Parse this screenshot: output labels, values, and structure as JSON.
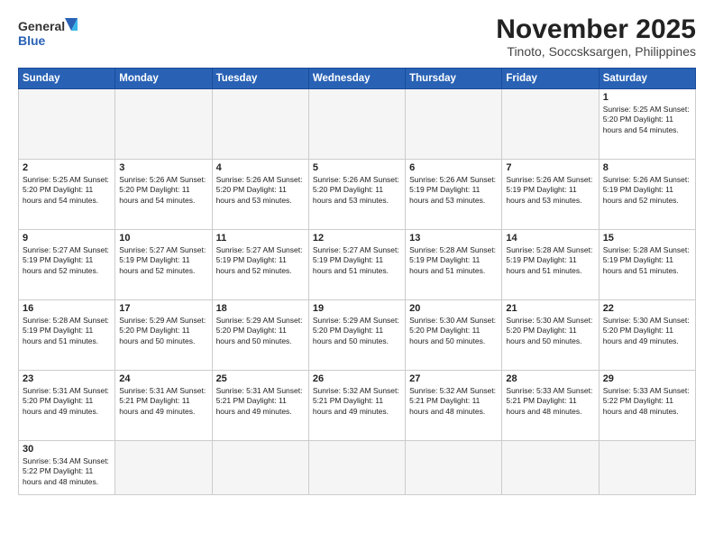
{
  "logo": {
    "line1": "General",
    "line2": "Blue"
  },
  "title": "November 2025",
  "location": "Tinoto, Soccsksargen, Philippines",
  "weekdays": [
    "Sunday",
    "Monday",
    "Tuesday",
    "Wednesday",
    "Thursday",
    "Friday",
    "Saturday"
  ],
  "weeks": [
    [
      {
        "day": "",
        "info": ""
      },
      {
        "day": "",
        "info": ""
      },
      {
        "day": "",
        "info": ""
      },
      {
        "day": "",
        "info": ""
      },
      {
        "day": "",
        "info": ""
      },
      {
        "day": "",
        "info": ""
      },
      {
        "day": "1",
        "info": "Sunrise: 5:25 AM\nSunset: 5:20 PM\nDaylight: 11 hours\nand 54 minutes."
      }
    ],
    [
      {
        "day": "2",
        "info": "Sunrise: 5:25 AM\nSunset: 5:20 PM\nDaylight: 11 hours\nand 54 minutes."
      },
      {
        "day": "3",
        "info": "Sunrise: 5:26 AM\nSunset: 5:20 PM\nDaylight: 11 hours\nand 54 minutes."
      },
      {
        "day": "4",
        "info": "Sunrise: 5:26 AM\nSunset: 5:20 PM\nDaylight: 11 hours\nand 53 minutes."
      },
      {
        "day": "5",
        "info": "Sunrise: 5:26 AM\nSunset: 5:20 PM\nDaylight: 11 hours\nand 53 minutes."
      },
      {
        "day": "6",
        "info": "Sunrise: 5:26 AM\nSunset: 5:19 PM\nDaylight: 11 hours\nand 53 minutes."
      },
      {
        "day": "7",
        "info": "Sunrise: 5:26 AM\nSunset: 5:19 PM\nDaylight: 11 hours\nand 53 minutes."
      },
      {
        "day": "8",
        "info": "Sunrise: 5:26 AM\nSunset: 5:19 PM\nDaylight: 11 hours\nand 52 minutes."
      }
    ],
    [
      {
        "day": "9",
        "info": "Sunrise: 5:27 AM\nSunset: 5:19 PM\nDaylight: 11 hours\nand 52 minutes."
      },
      {
        "day": "10",
        "info": "Sunrise: 5:27 AM\nSunset: 5:19 PM\nDaylight: 11 hours\nand 52 minutes."
      },
      {
        "day": "11",
        "info": "Sunrise: 5:27 AM\nSunset: 5:19 PM\nDaylight: 11 hours\nand 52 minutes."
      },
      {
        "day": "12",
        "info": "Sunrise: 5:27 AM\nSunset: 5:19 PM\nDaylight: 11 hours\nand 51 minutes."
      },
      {
        "day": "13",
        "info": "Sunrise: 5:28 AM\nSunset: 5:19 PM\nDaylight: 11 hours\nand 51 minutes."
      },
      {
        "day": "14",
        "info": "Sunrise: 5:28 AM\nSunset: 5:19 PM\nDaylight: 11 hours\nand 51 minutes."
      },
      {
        "day": "15",
        "info": "Sunrise: 5:28 AM\nSunset: 5:19 PM\nDaylight: 11 hours\nand 51 minutes."
      }
    ],
    [
      {
        "day": "16",
        "info": "Sunrise: 5:28 AM\nSunset: 5:19 PM\nDaylight: 11 hours\nand 51 minutes."
      },
      {
        "day": "17",
        "info": "Sunrise: 5:29 AM\nSunset: 5:20 PM\nDaylight: 11 hours\nand 50 minutes."
      },
      {
        "day": "18",
        "info": "Sunrise: 5:29 AM\nSunset: 5:20 PM\nDaylight: 11 hours\nand 50 minutes."
      },
      {
        "day": "19",
        "info": "Sunrise: 5:29 AM\nSunset: 5:20 PM\nDaylight: 11 hours\nand 50 minutes."
      },
      {
        "day": "20",
        "info": "Sunrise: 5:30 AM\nSunset: 5:20 PM\nDaylight: 11 hours\nand 50 minutes."
      },
      {
        "day": "21",
        "info": "Sunrise: 5:30 AM\nSunset: 5:20 PM\nDaylight: 11 hours\nand 50 minutes."
      },
      {
        "day": "22",
        "info": "Sunrise: 5:30 AM\nSunset: 5:20 PM\nDaylight: 11 hours\nand 49 minutes."
      }
    ],
    [
      {
        "day": "23",
        "info": "Sunrise: 5:31 AM\nSunset: 5:20 PM\nDaylight: 11 hours\nand 49 minutes."
      },
      {
        "day": "24",
        "info": "Sunrise: 5:31 AM\nSunset: 5:21 PM\nDaylight: 11 hours\nand 49 minutes."
      },
      {
        "day": "25",
        "info": "Sunrise: 5:31 AM\nSunset: 5:21 PM\nDaylight: 11 hours\nand 49 minutes."
      },
      {
        "day": "26",
        "info": "Sunrise: 5:32 AM\nSunset: 5:21 PM\nDaylight: 11 hours\nand 49 minutes."
      },
      {
        "day": "27",
        "info": "Sunrise: 5:32 AM\nSunset: 5:21 PM\nDaylight: 11 hours\nand 48 minutes."
      },
      {
        "day": "28",
        "info": "Sunrise: 5:33 AM\nSunset: 5:21 PM\nDaylight: 11 hours\nand 48 minutes."
      },
      {
        "day": "29",
        "info": "Sunrise: 5:33 AM\nSunset: 5:22 PM\nDaylight: 11 hours\nand 48 minutes."
      }
    ],
    [
      {
        "day": "30",
        "info": "Sunrise: 5:34 AM\nSunset: 5:22 PM\nDaylight: 11 hours\nand 48 minutes."
      },
      {
        "day": "",
        "info": ""
      },
      {
        "day": "",
        "info": ""
      },
      {
        "day": "",
        "info": ""
      },
      {
        "day": "",
        "info": ""
      },
      {
        "day": "",
        "info": ""
      },
      {
        "day": "",
        "info": ""
      }
    ]
  ]
}
